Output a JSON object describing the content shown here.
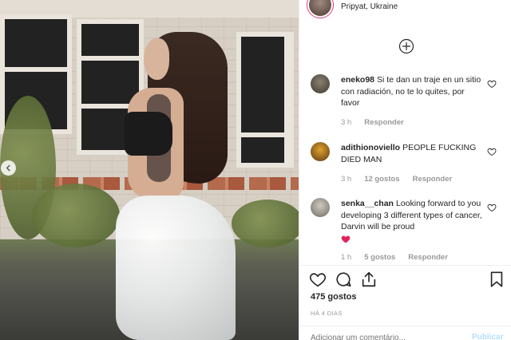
{
  "post": {
    "location": "Pripyat, Ukraine",
    "likes_count": "475 gostos",
    "date": "HÁ 4 DIAS",
    "add_comment_placeholder": "Adicionar um comentário...",
    "publish_label": "Publicar"
  },
  "comments": [
    {
      "username": "eneko98",
      "text": "Si te dan un traje en un sitio con radiación, no te lo quites, por favor",
      "time": "3 h",
      "likes": "",
      "reply_label": "Responder"
    },
    {
      "username": "adithionoviello",
      "text": "PEOPLE FUCKING DIED MAN",
      "time": "3 h",
      "likes": "12 gostos",
      "reply_label": "Responder"
    },
    {
      "username": "senka__chan",
      "text": "Looking forward to you developing 3 different types of cancer, Darvin will be proud",
      "emoji": "red-heart",
      "time": "1 h",
      "likes": "5 gostos",
      "reply_label": "Responder"
    }
  ],
  "icons": {
    "heart": "heart-outline-icon",
    "comment": "comment-bubble-icon",
    "share": "share-icon",
    "save": "bookmark-icon",
    "plus": "plus-circle-icon",
    "prev": "chevron-left-icon"
  },
  "colors": {
    "accent_red": "#ed4956",
    "link_blue_disabled": "#b2dffc",
    "meta_gray": "#999999"
  }
}
